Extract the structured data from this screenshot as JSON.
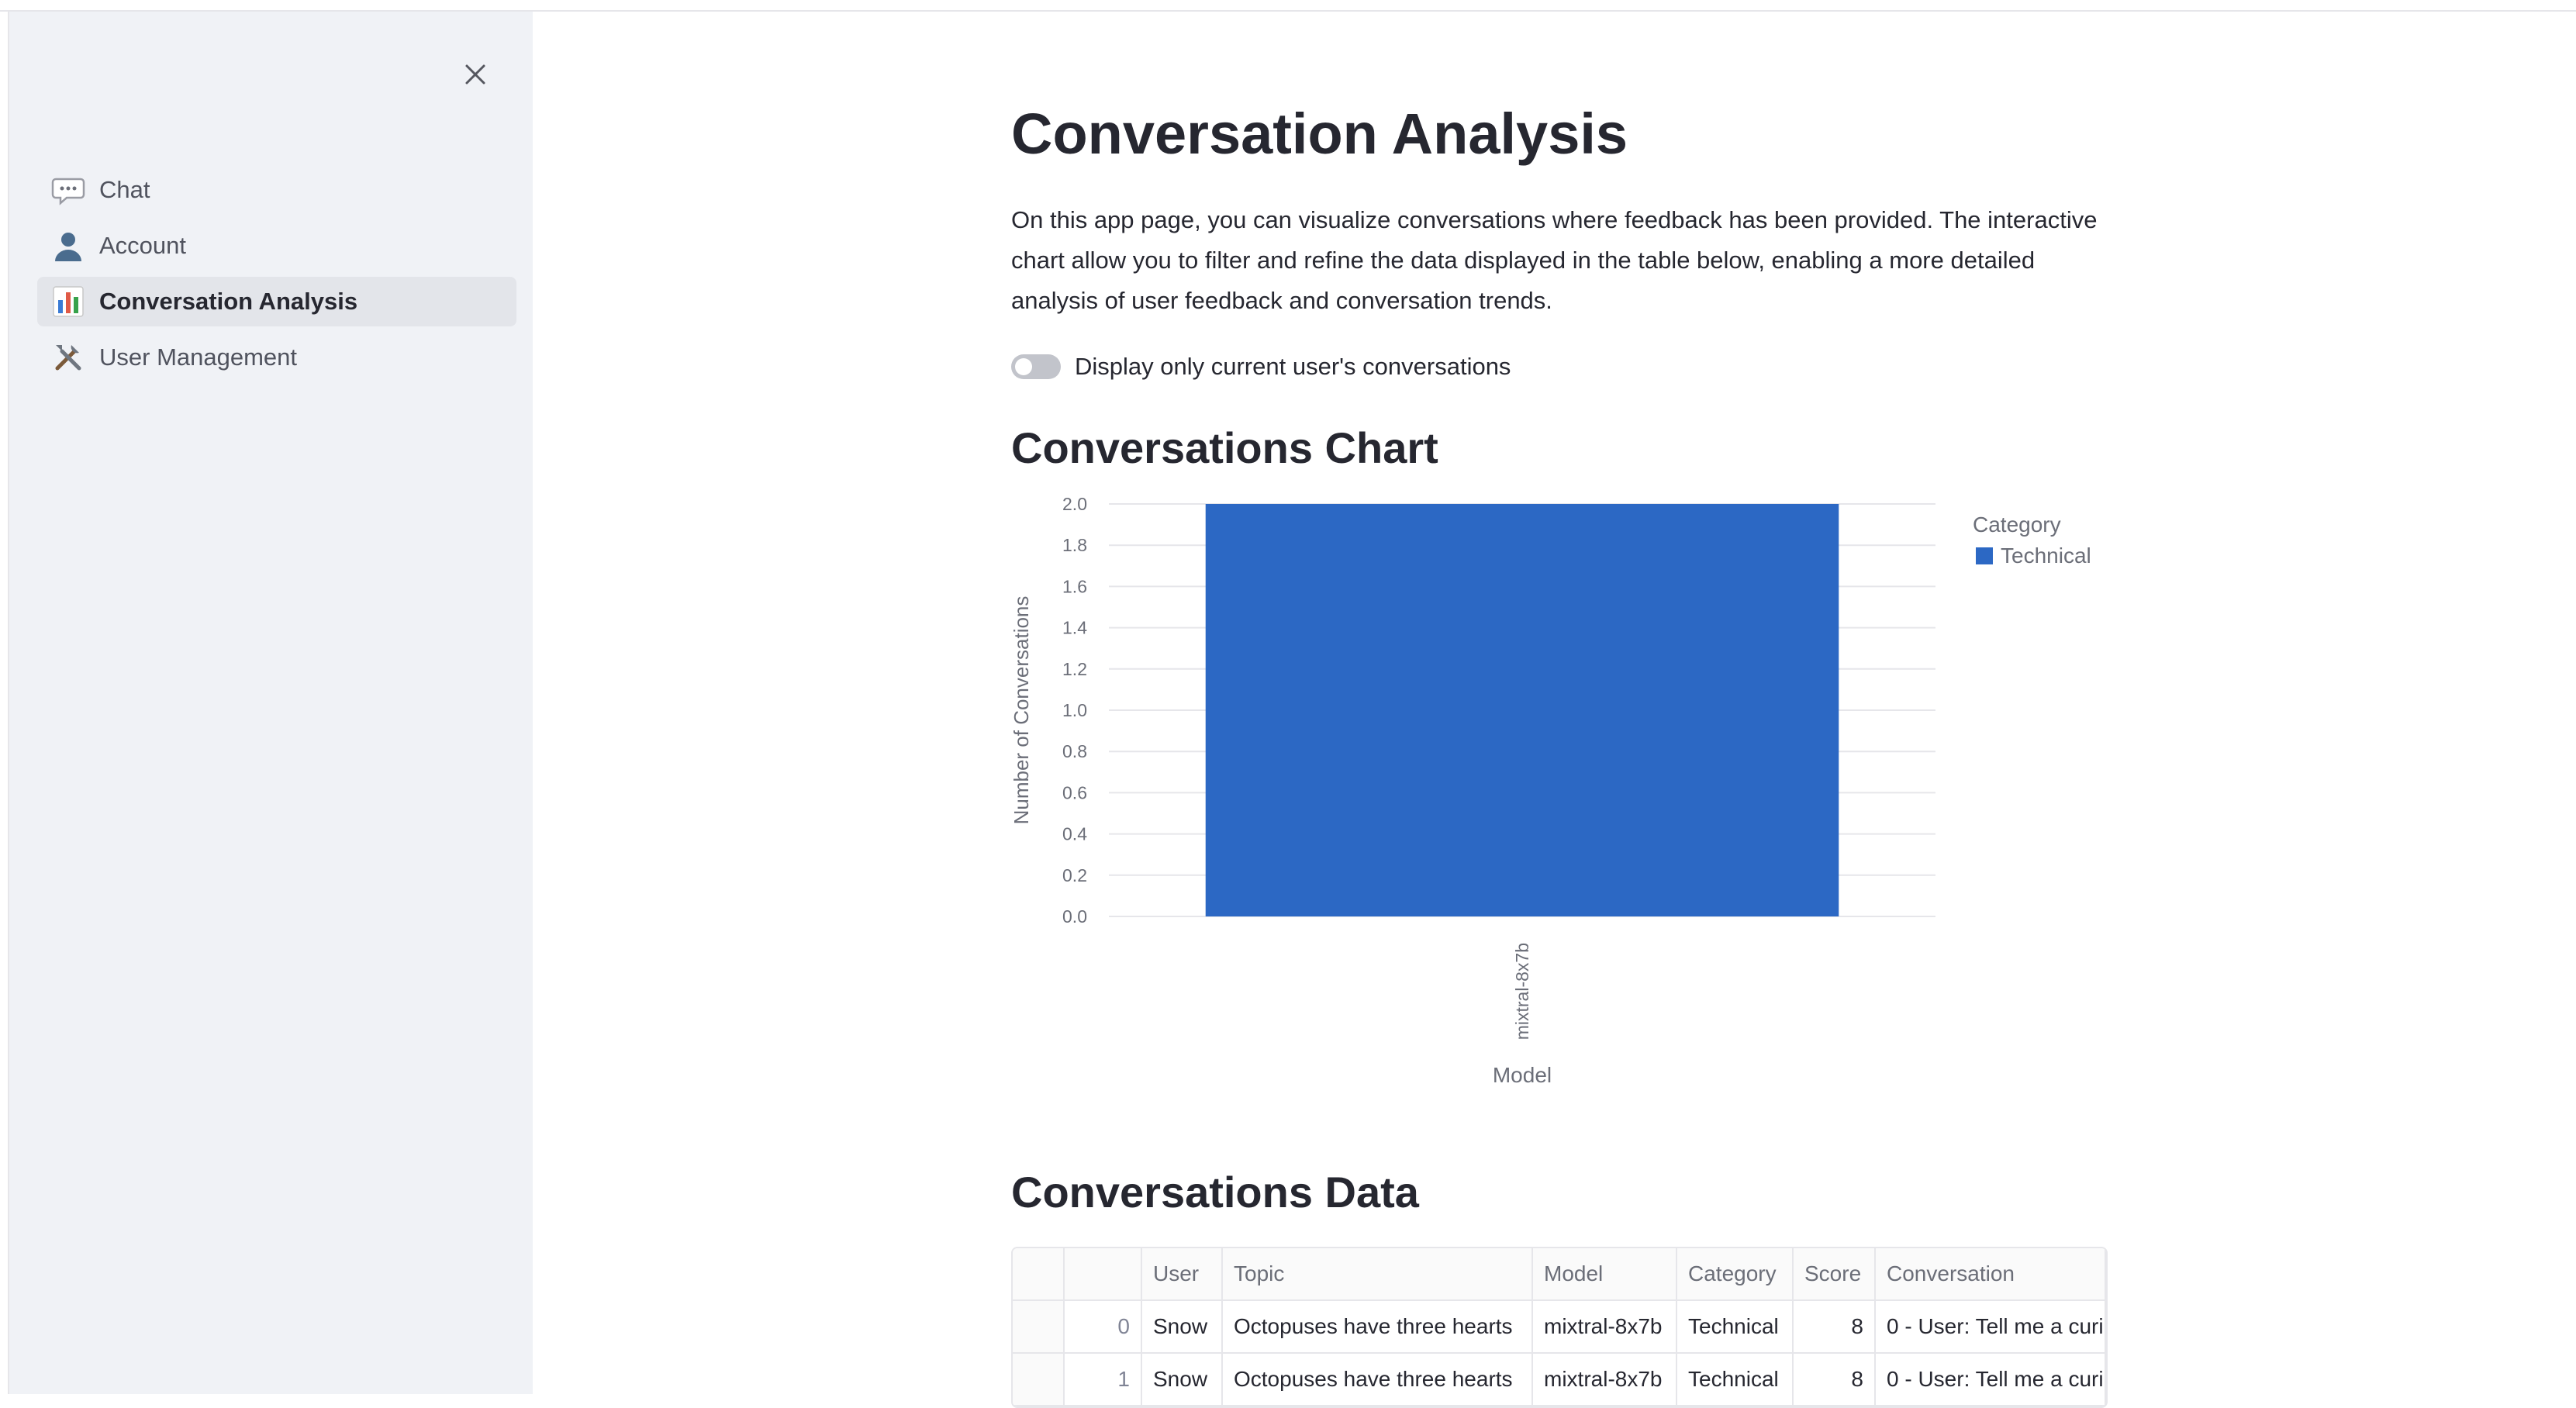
{
  "sidebar": {
    "items": [
      {
        "label": "Chat",
        "icon": "speech-bubble-icon"
      },
      {
        "label": "Account",
        "icon": "user-icon"
      },
      {
        "label": "Conversation Analysis",
        "icon": "bar-chart-icon",
        "active": true
      },
      {
        "label": "User Management",
        "icon": "tools-icon"
      }
    ]
  },
  "page": {
    "title": "Conversation Analysis",
    "intro": "On this app page, you can visualize conversations where feedback has been provided. The interactive chart allow you to filter and refine the data displayed in the table below, enabling a more detailed analysis of user feedback and conversation trends.",
    "toggle_label": "Display only current user's conversations",
    "toggle_on": false,
    "chart_heading": "Conversations Chart",
    "data_heading": "Conversations Data"
  },
  "chart_data": {
    "type": "bar",
    "categories": [
      "mixtral-8x7b"
    ],
    "series": [
      {
        "name": "Technical",
        "values": [
          2.0
        ],
        "color": "#2c68c4"
      }
    ],
    "xlabel": "Model",
    "ylabel": "Number of Conversations",
    "yticks": [
      "0.0",
      "0.2",
      "0.4",
      "0.6",
      "0.8",
      "1.0",
      "1.2",
      "1.4",
      "1.6",
      "1.8",
      "2.0"
    ],
    "ylim": [
      0,
      2.0
    ],
    "legend_title": "Category",
    "legend_placement": "right",
    "grid": true
  },
  "table": {
    "columns": [
      "",
      "",
      "User",
      "Topic",
      "Model",
      "Category",
      "Score",
      "Conversation"
    ],
    "rows": [
      {
        "index": "0",
        "user": "Snow",
        "topic": "Octopuses have three hearts",
        "model": "mixtral-8x7b",
        "category": "Technical",
        "score": "8",
        "conversation": "0 - User: Tell me a curi"
      },
      {
        "index": "1",
        "user": "Snow",
        "topic": "Octopuses have three hearts",
        "model": "mixtral-8x7b",
        "category": "Technical",
        "score": "8",
        "conversation": "0 - User: Tell me a curi"
      }
    ]
  },
  "colors": {
    "accent": "#2c68c4",
    "sidebar_bg": "#f0f2f6"
  }
}
